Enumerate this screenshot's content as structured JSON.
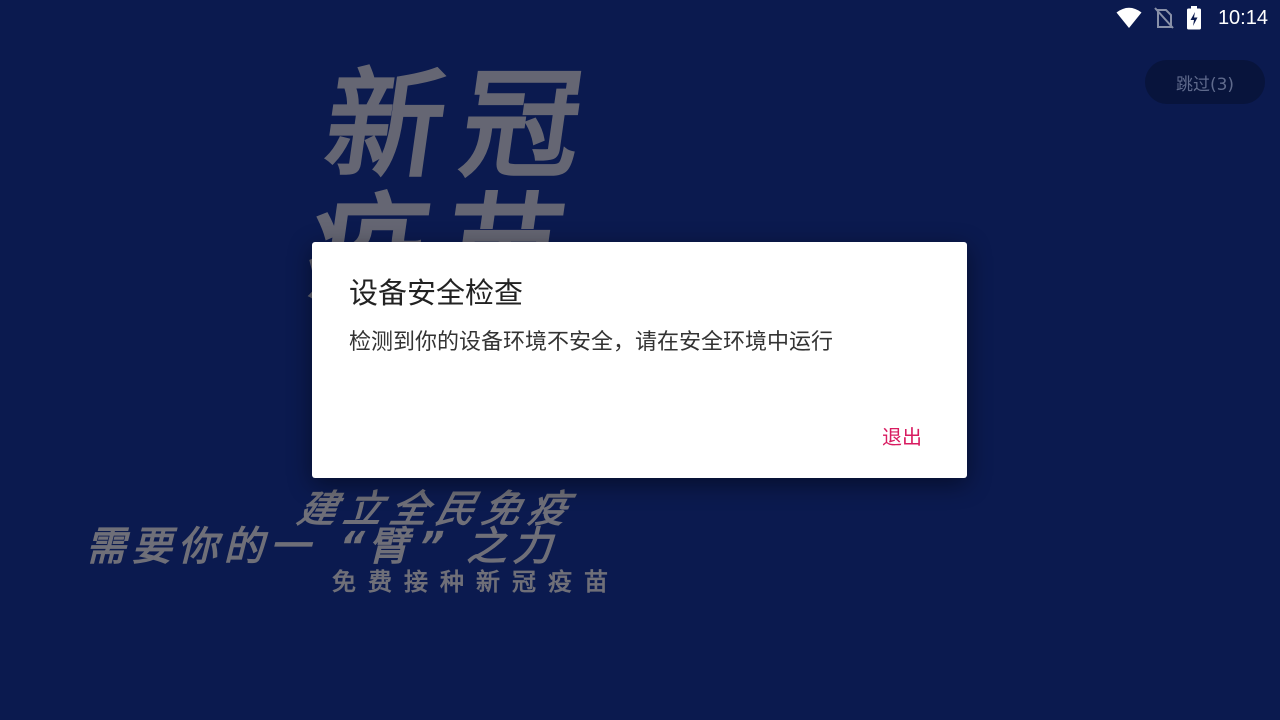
{
  "status_bar": {
    "time": "10:14",
    "icons": [
      "wifi-icon",
      "no-sim-icon",
      "battery-charging-icon"
    ]
  },
  "skip_button": {
    "label": "跳过(3)"
  },
  "poster": {
    "headline_row1": "新冠",
    "headline_row2": "疫苗",
    "slogan_line1": "建立全民免疫",
    "slogan_line2": "需要你的一 “臂” 之力",
    "slogan_line3": "免费接种新冠疫苗"
  },
  "dialog": {
    "title": "设备安全检查",
    "message": "检测到你的设备环境不安全，请在安全环境中运行",
    "exit_label": "退出"
  },
  "colors": {
    "background": "#0b1a4f",
    "accent": "#d81b60",
    "poster_text": "#6f6f78"
  }
}
